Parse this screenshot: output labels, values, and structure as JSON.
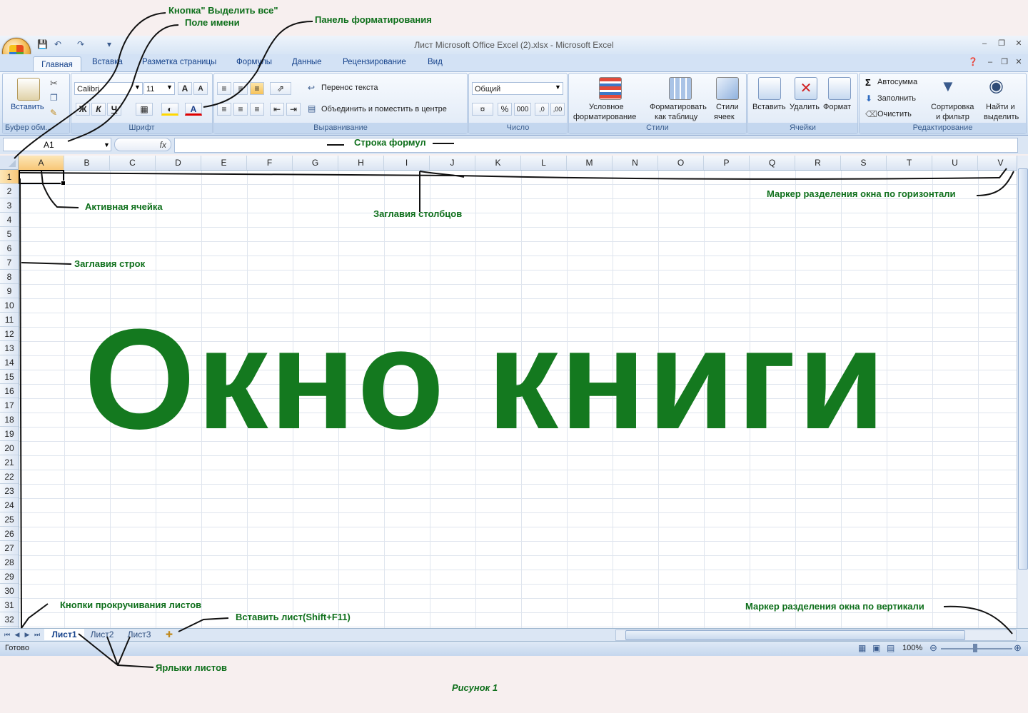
{
  "window": {
    "title": "Лист Microsoft Office Excel (2).xlsx - Microsoft Excel"
  },
  "tabs": [
    "Главная",
    "Вставка",
    "Разметка страницы",
    "Формулы",
    "Данные",
    "Рецензирование",
    "Вид"
  ],
  "ribbon": {
    "clipboard": {
      "paste_label": "Вставить",
      "group_label": "Буфер обм..."
    },
    "font": {
      "font_name": "Calibri",
      "font_size": "11",
      "bold": "Ж",
      "italic": "К",
      "underline": "Ч",
      "grow": "A",
      "shrink": "A",
      "color_letter": "A",
      "group_label": "Шрифт"
    },
    "alignment": {
      "wrap_label": "Перенос текста",
      "merge_label": "Объединить и поместить в центре",
      "group_label": "Выравнивание"
    },
    "number": {
      "format": "Общий",
      "percent": "%",
      "thousands": "000",
      "group_label": "Число"
    },
    "styles": {
      "conditional_1": "Условное",
      "conditional_2": "форматирование",
      "table_1": "Форматировать",
      "table_2": "как таблицу",
      "cell_1": "Стили",
      "cell_2": "ячеек",
      "group_label": "Стили"
    },
    "cells": {
      "insert": "Вставить",
      "delete": "Удалить",
      "format": "Формат",
      "group_label": "Ячейки"
    },
    "editing": {
      "autosum": "Автосумма",
      "fill": "Заполнить",
      "clear": "Очистить",
      "sort_1": "Сортировка",
      "sort_2": "и фильтр",
      "find_1": "Найти и",
      "find_2": "выделить",
      "group_label": "Редактирование"
    }
  },
  "formula_bar": {
    "name_box": "A1",
    "fx": "fx"
  },
  "columns": [
    "A",
    "B",
    "C",
    "D",
    "E",
    "F",
    "G",
    "H",
    "I",
    "J",
    "K",
    "L",
    "M",
    "N",
    "O",
    "P",
    "Q",
    "R",
    "S",
    "T",
    "U",
    "V"
  ],
  "rows": [
    "1",
    "2",
    "3",
    "4",
    "5",
    "6",
    "7",
    "8",
    "9",
    "10",
    "11",
    "12",
    "13",
    "14",
    "15",
    "16",
    "17",
    "18",
    "19",
    "20",
    "21",
    "22",
    "23",
    "24",
    "25",
    "26",
    "27",
    "28",
    "29",
    "30",
    "31",
    "32"
  ],
  "sheets": [
    "Лист1",
    "Лист2",
    "Лист3"
  ],
  "status": {
    "ready": "Готово",
    "zoom": "100%"
  },
  "annotations": {
    "select_all": "Кнопка\" Выделить все\"",
    "name_box": "Поле имени",
    "format_panel": "Панель форматирования",
    "formula_bar": "Строка формул",
    "active_cell": "Активная ячейка",
    "col_headers": "Заглавия столбцов",
    "h_split": "Маркер разделения окна по горизонтали",
    "row_headers": "Заглавия строк",
    "scroll_buttons": "Кнопки прокручивания листов",
    "insert_sheet": "Вставить лист(Shift+F11)",
    "v_split": "Маркер разделения окна по вертикали",
    "sheet_tabs": "Ярлыки листов",
    "big_title": "Окно книги",
    "caption": "Рисунок 1"
  },
  "colors": {
    "annotation": "#0e6f1b",
    "big_title": "#14791f",
    "ribbon": "#dbe7f6"
  }
}
